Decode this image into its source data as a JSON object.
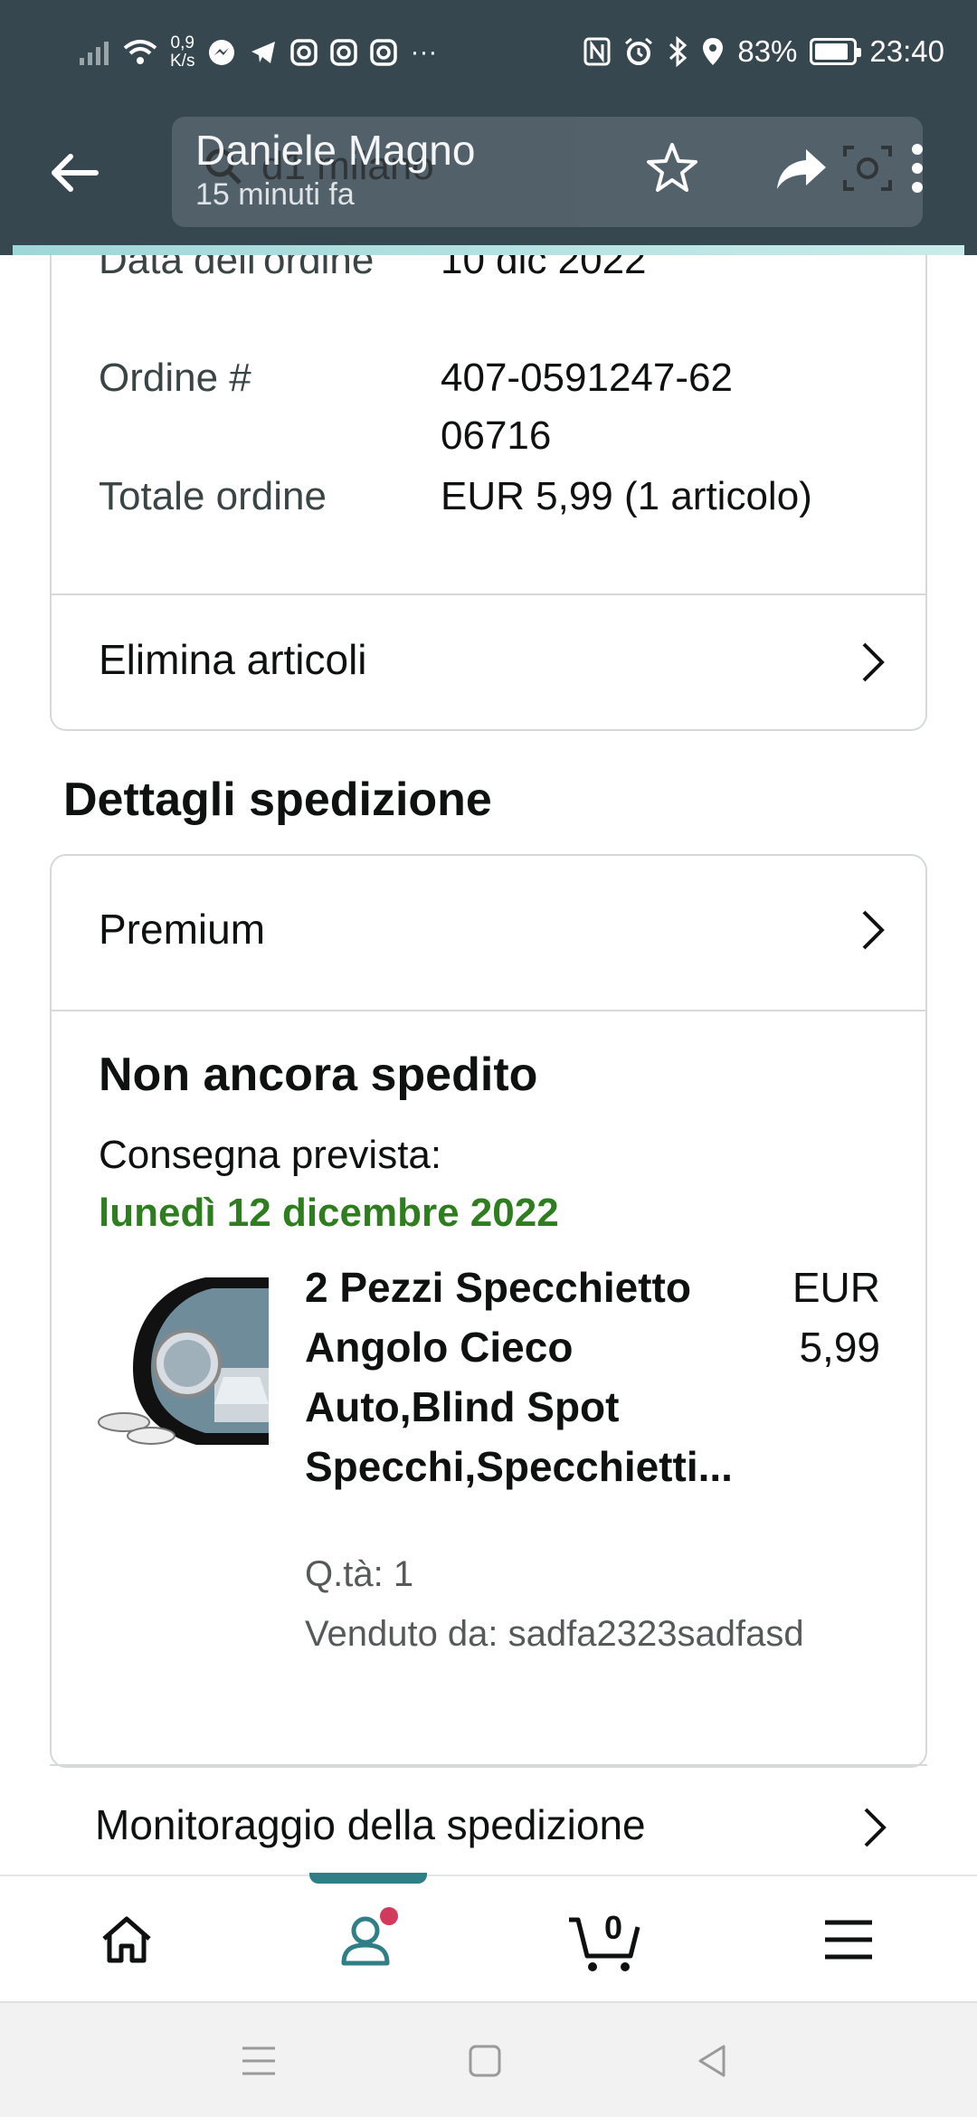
{
  "status_bar": {
    "speed_top": "0,9",
    "speed_bottom": "K/s",
    "battery": "83%",
    "time": "23:40"
  },
  "viewer": {
    "sender_name": "Daniele Magno",
    "sent_time": "15 minuti fa",
    "ghost_search_text": "d1 milano"
  },
  "order_summary": {
    "rows": [
      {
        "label": "Data dell'ordine",
        "value": "10 dic 2022"
      },
      {
        "label": "Ordine #",
        "value": "407-0591247-6206716"
      },
      {
        "label": "Totale ordine",
        "value": "EUR 5,99 (1 articolo)"
      }
    ],
    "delete_items": "Elimina articoli"
  },
  "shipping": {
    "section_title": "Dettagli spedizione",
    "service": "Premium",
    "status": "Non ancora spedito",
    "delivery_label": "Consegna prevista:",
    "delivery_date": "lunedì 12 dicembre 2022",
    "product": {
      "title": "2 Pezzi Specchietto Angolo Cieco Auto,Blind Spot Specchi,Specchietti...",
      "price": "EUR 5,99",
      "quantity": "Q.tà: 1",
      "seller": "Venduto da: sadfa2323sadfasd"
    },
    "tracking": "Monitoraggio della spedizione"
  },
  "bottom_nav": {
    "cart_count": "0",
    "items": [
      "home-icon",
      "account-icon",
      "cart-icon",
      "menu-icon"
    ]
  },
  "colors": {
    "header_bg": "#37474f",
    "delivery_green": "#2e7d1f",
    "nav_accent": "#2f7f86",
    "badge": "#d13a5a"
  }
}
